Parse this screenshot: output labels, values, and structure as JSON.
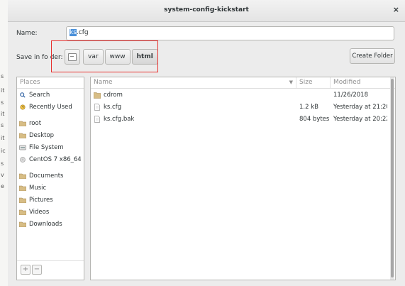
{
  "window": {
    "title": "system-config-kickstart",
    "close_glyph": "×"
  },
  "name_field": {
    "label": "Name:",
    "value_selected": "ks",
    "value_rest": ".cfg"
  },
  "folder": {
    "label_before": "Save in fo",
    "label_after": "der:",
    "path": [
      "var",
      "www",
      "html"
    ]
  },
  "create_folder_label": "Create Folder",
  "left_strip": [
    "s",
    "it",
    "s",
    "it",
    "s",
    "it",
    "ic",
    "s",
    "v",
    "e"
  ],
  "places": {
    "header": "Places",
    "items": [
      {
        "label": "Search",
        "icon": "search-icon"
      },
      {
        "label": "Recently Used",
        "icon": "clock-icon"
      },
      {
        "label": "root",
        "icon": "folder-icon"
      },
      {
        "label": "Desktop",
        "icon": "folder-icon"
      },
      {
        "label": "File System",
        "icon": "drive-icon"
      },
      {
        "label": "CentOS 7 x86_64",
        "icon": "disc-icon"
      },
      {
        "label": "Documents",
        "icon": "folder-icon"
      },
      {
        "label": "Music",
        "icon": "folder-icon"
      },
      {
        "label": "Pictures",
        "icon": "folder-icon"
      },
      {
        "label": "Videos",
        "icon": "folder-icon"
      },
      {
        "label": "Downloads",
        "icon": "folder-icon"
      }
    ],
    "add_label": "+",
    "remove_label": "−"
  },
  "files": {
    "columns": {
      "name": "Name",
      "size": "Size",
      "modified": "Modified"
    },
    "rows": [
      {
        "name": "cdrom",
        "size": "",
        "modified": "11/26/2018",
        "icon": "folder-icon"
      },
      {
        "name": "ks.cfg",
        "size": "1.2 kB",
        "modified": "Yesterday at 21:20",
        "icon": "file-icon"
      },
      {
        "name": "ks.cfg.bak",
        "size": "804 bytes",
        "modified": "Yesterday at 20:22",
        "icon": "file-icon"
      }
    ]
  },
  "colors": {
    "selection": "#4a90d9",
    "annotation": "#e8312f",
    "folder": "#c4a56d"
  }
}
